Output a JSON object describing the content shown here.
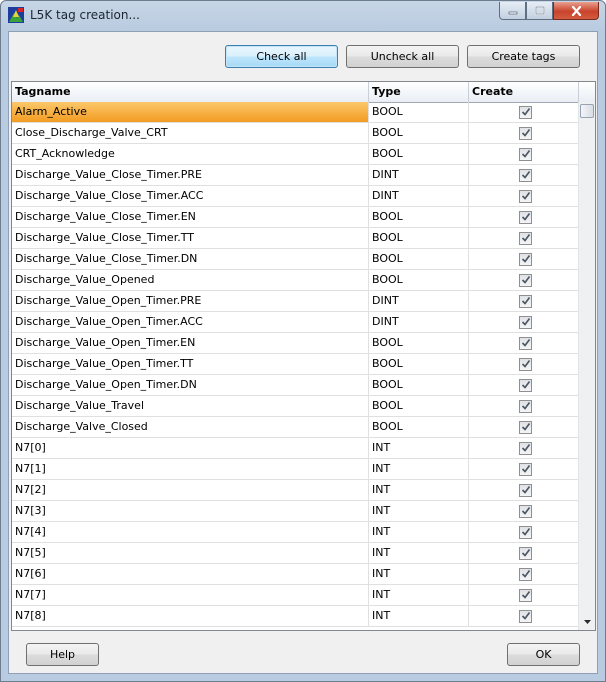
{
  "window": {
    "title": "L5K tag creation...",
    "colors": {
      "selection": "#f39c21",
      "close_button": "#c8432b"
    }
  },
  "toolbar": {
    "check_all_label": "Check all",
    "uncheck_all_label": "Uncheck all",
    "create_tags_label": "Create tags"
  },
  "table": {
    "headers": {
      "tagname": "Tagname",
      "type": "Type",
      "create": "Create"
    },
    "rows": [
      {
        "tagname": "Alarm_Active",
        "type": "BOOL",
        "create": true
      },
      {
        "tagname": "Close_Discharge_Valve_CRT",
        "type": "BOOL",
        "create": true
      },
      {
        "tagname": "CRT_Acknowledge",
        "type": "BOOL",
        "create": true
      },
      {
        "tagname": "Discharge_Value_Close_Timer.PRE",
        "type": "DINT",
        "create": true
      },
      {
        "tagname": "Discharge_Value_Close_Timer.ACC",
        "type": "DINT",
        "create": true
      },
      {
        "tagname": "Discharge_Value_Close_Timer.EN",
        "type": "BOOL",
        "create": true
      },
      {
        "tagname": "Discharge_Value_Close_Timer.TT",
        "type": "BOOL",
        "create": true
      },
      {
        "tagname": "Discharge_Value_Close_Timer.DN",
        "type": "BOOL",
        "create": true
      },
      {
        "tagname": "Discharge_Value_Opened",
        "type": "BOOL",
        "create": true
      },
      {
        "tagname": "Discharge_Value_Open_Timer.PRE",
        "type": "DINT",
        "create": true
      },
      {
        "tagname": "Discharge_Value_Open_Timer.ACC",
        "type": "DINT",
        "create": true
      },
      {
        "tagname": "Discharge_Value_Open_Timer.EN",
        "type": "BOOL",
        "create": true
      },
      {
        "tagname": "Discharge_Value_Open_Timer.TT",
        "type": "BOOL",
        "create": true
      },
      {
        "tagname": "Discharge_Value_Open_Timer.DN",
        "type": "BOOL",
        "create": true
      },
      {
        "tagname": "Discharge_Value_Travel",
        "type": "BOOL",
        "create": true
      },
      {
        "tagname": "Discharge_Valve_Closed",
        "type": "BOOL",
        "create": true
      },
      {
        "tagname": "N7[0]",
        "type": "INT",
        "create": true
      },
      {
        "tagname": "N7[1]",
        "type": "INT",
        "create": true
      },
      {
        "tagname": "N7[2]",
        "type": "INT",
        "create": true
      },
      {
        "tagname": "N7[3]",
        "type": "INT",
        "create": true
      },
      {
        "tagname": "N7[4]",
        "type": "INT",
        "create": true
      },
      {
        "tagname": "N7[5]",
        "type": "INT",
        "create": true
      },
      {
        "tagname": "N7[6]",
        "type": "INT",
        "create": true
      },
      {
        "tagname": "N7[7]",
        "type": "INT",
        "create": true
      },
      {
        "tagname": "N7[8]",
        "type": "INT",
        "create": true
      }
    ],
    "selected_row": 0
  },
  "footer": {
    "help_label": "Help",
    "ok_label": "OK"
  }
}
